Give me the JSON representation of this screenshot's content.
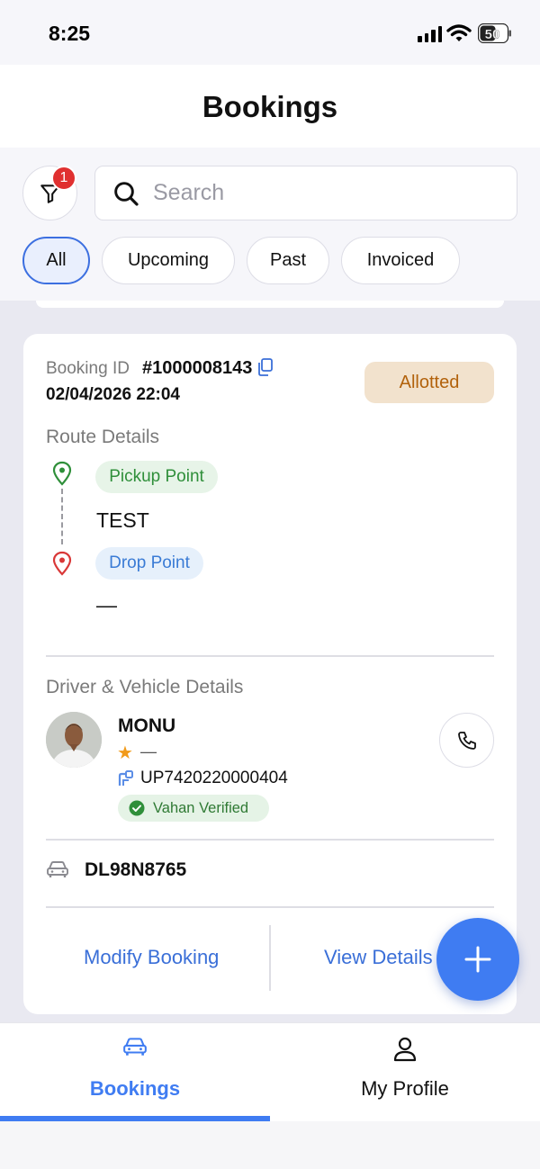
{
  "status_bar": {
    "time": "8:25",
    "battery": "50"
  },
  "header": {
    "title": "Bookings"
  },
  "filter": {
    "badge_count": "1"
  },
  "search": {
    "placeholder": "Search"
  },
  "chips": [
    {
      "label": "All",
      "active": true
    },
    {
      "label": "Upcoming",
      "active": false
    },
    {
      "label": "Past",
      "active": false
    },
    {
      "label": "Invoiced",
      "active": false
    }
  ],
  "booking": {
    "id_label": "Booking ID",
    "id_value": "#1000008143",
    "datetime": "02/04/2026 22:04",
    "status": "Allotted",
    "route_title": "Route Details",
    "pickup_label": "Pickup Point",
    "pickup_value": "TEST",
    "drop_label": "Drop Point",
    "drop_value": "—",
    "driver_section_title": "Driver & Vehicle Details",
    "driver_name": "MONU",
    "driver_rating": "—",
    "license_number": "UP7420220000404",
    "verified_label": "Vahan Verified",
    "vehicle_number": "DL98N8765",
    "modify_label": "Modify Booking",
    "view_label": "View Details"
  },
  "tabbar": {
    "bookings_label": "Bookings",
    "profile_label": "My Profile"
  },
  "colors": {
    "accent": "#3f7cf2",
    "status_bg": "#f2e2cd",
    "status_text": "#b2620c",
    "pickup_green": "#2f8f3a",
    "drop_red": "#d93838",
    "badge_red": "#e03030"
  },
  "icons": [
    "filter-icon",
    "search-icon",
    "copy-icon",
    "pickup-pin-icon",
    "drop-pin-icon",
    "star-icon",
    "license-icon",
    "check-circle-icon",
    "phone-icon",
    "car-icon",
    "plus-icon",
    "user-icon"
  ]
}
